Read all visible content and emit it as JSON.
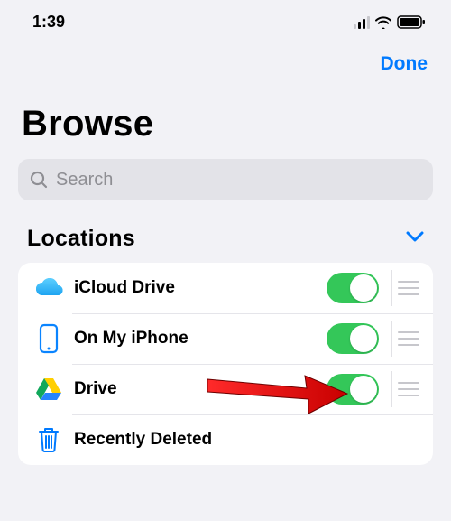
{
  "status": {
    "time": "1:39"
  },
  "nav": {
    "done_label": "Done"
  },
  "page": {
    "title": "Browse"
  },
  "search": {
    "placeholder": "Search"
  },
  "section": {
    "title": "Locations"
  },
  "rows": [
    {
      "label": "iCloud Drive",
      "icon": "cloud",
      "toggle_on": true,
      "has_toggle": true,
      "has_handle": true
    },
    {
      "label": "On My iPhone",
      "icon": "iphone",
      "toggle_on": true,
      "has_toggle": true,
      "has_handle": true
    },
    {
      "label": "Drive",
      "icon": "gdrive",
      "toggle_on": true,
      "has_toggle": true,
      "has_handle": true
    },
    {
      "label": "Recently Deleted",
      "icon": "trash",
      "toggle_on": false,
      "has_toggle": false,
      "has_handle": false
    }
  ],
  "colors": {
    "accent": "#007aff",
    "toggle_on": "#34c759",
    "bg": "#f2f2f6",
    "arrow": "#e30000"
  }
}
